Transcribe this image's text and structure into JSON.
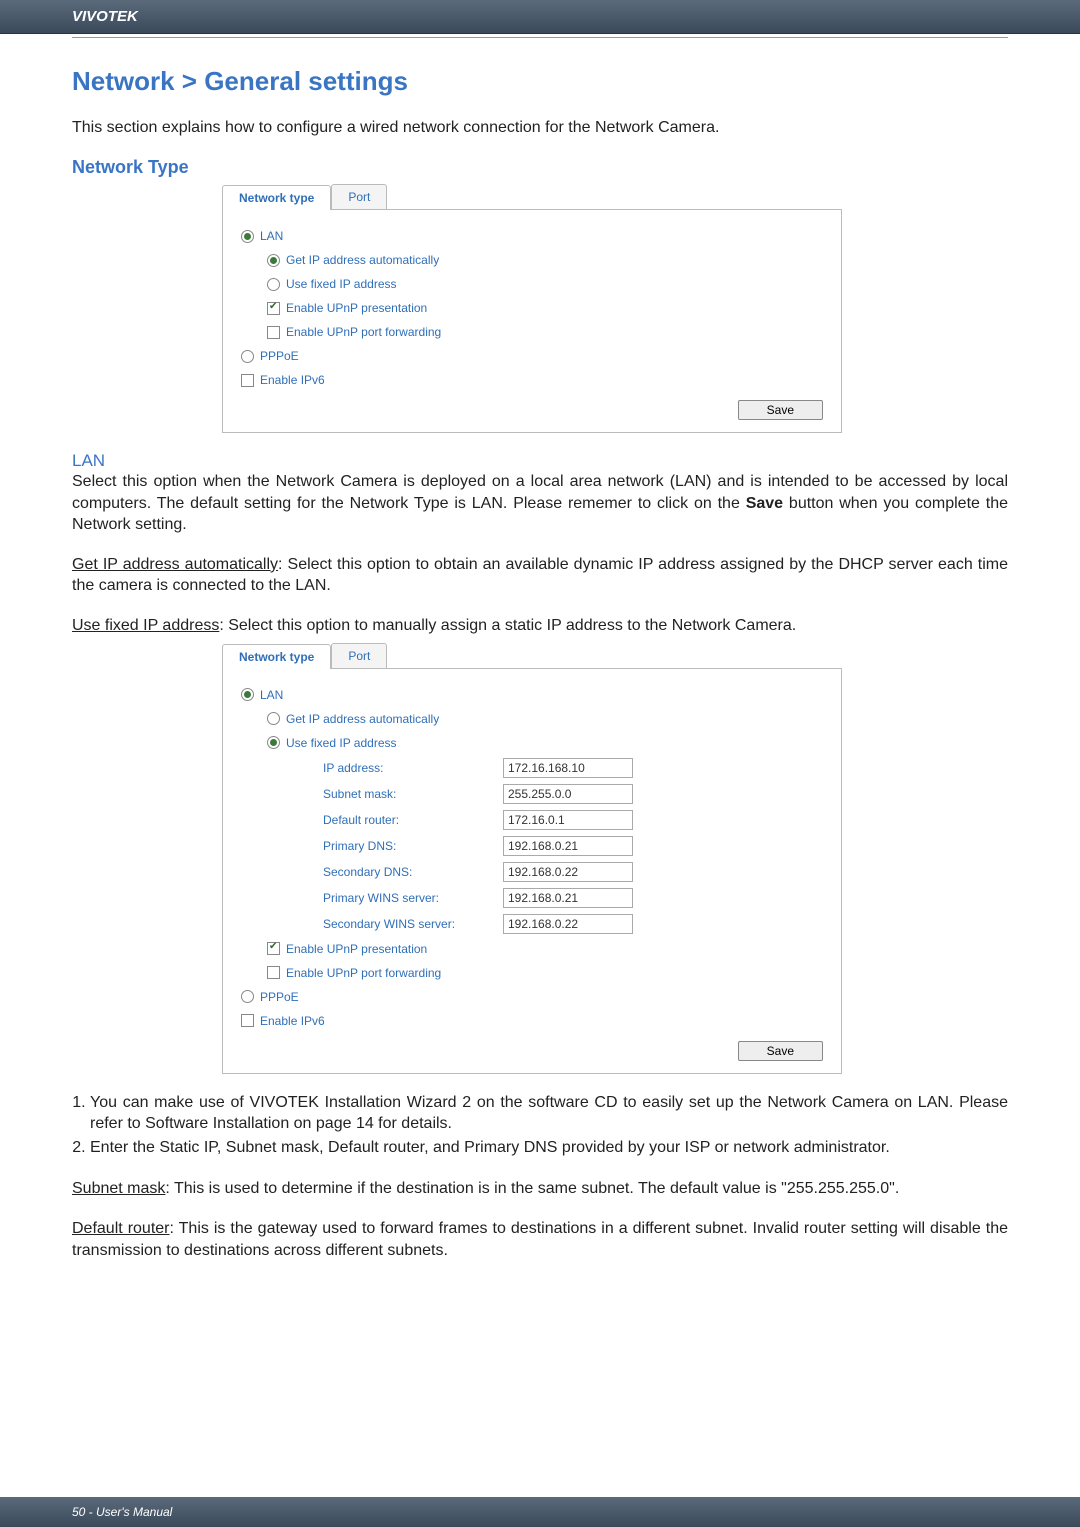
{
  "header": {
    "brand": "VIVOTEK"
  },
  "title": "Network > General settings",
  "intro": "This section explains how to configure a wired network connection for the Network Camera.",
  "network_type_heading": "Network Type",
  "panel1": {
    "tabs": {
      "network_type": "Network type",
      "port": "Port"
    },
    "lan": "LAN",
    "get_ip": "Get IP address automatically",
    "fixed_ip": "Use fixed IP address",
    "upnp_pres": "Enable UPnP presentation",
    "upnp_port": "Enable UPnP port forwarding",
    "pppoe": "PPPoE",
    "ipv6": "Enable IPv6",
    "save": "Save"
  },
  "lan_section": {
    "heading": "LAN",
    "para": "Select this option when the Network Camera is deployed on a local area network (LAN) and is intended to be accessed by local computers. The default setting for the Network Type is LAN. Please rememer to click on the Save button when you complete the Network setting.",
    "save_word": "Save",
    "get_ip_label": "Get IP address automatically",
    "get_ip_desc": ": Select this option to obtain an available dynamic IP address assigned by the DHCP server each time the camera is connected to the LAN.",
    "fixed_ip_label": "Use fixed IP address",
    "fixed_ip_desc": ": Select this option to manually assign a static IP address to the Network Camera."
  },
  "panel2": {
    "tabs": {
      "network_type": "Network type",
      "port": "Port"
    },
    "lan": "LAN",
    "get_ip": "Get IP address automatically",
    "fixed_ip": "Use fixed IP address",
    "fields": {
      "ip_lbl": "IP address:",
      "ip_val": "172.16.168.10",
      "mask_lbl": "Subnet mask:",
      "mask_val": "255.255.0.0",
      "router_lbl": "Default router:",
      "router_val": "172.16.0.1",
      "pdns_lbl": "Primary DNS:",
      "pdns_val": "192.168.0.21",
      "sdns_lbl": "Secondary DNS:",
      "sdns_val": "192.168.0.22",
      "pwins_lbl": "Primary WINS server:",
      "pwins_val": "192.168.0.21",
      "swins_lbl": "Secondary WINS server:",
      "swins_val": "192.168.0.22"
    },
    "upnp_pres": "Enable UPnP presentation",
    "upnp_port": "Enable UPnP port forwarding",
    "pppoe": "PPPoE",
    "ipv6": "Enable IPv6",
    "save": "Save"
  },
  "steps": {
    "s1": "You can make use of VIVOTEK Installation Wizard 2 on the software CD to easily set up the Network Camera on LAN. Please refer to Software Installation on page 14 for details.",
    "s2": "Enter the Static IP, Subnet mask, Default router, and Primary DNS provided by your ISP or network administrator."
  },
  "subnet": {
    "label": "Subnet mask",
    "desc": ": This is used to determine if the destination is in the same subnet. The default value is \"255.255.255.0\"."
  },
  "default_router": {
    "label": "Default router",
    "desc": ": This is the gateway used to forward frames to destinations in a different subnet. Invalid router setting will disable the transmission to destinations across different subnets."
  },
  "footer": {
    "text": "50 - User's Manual"
  }
}
